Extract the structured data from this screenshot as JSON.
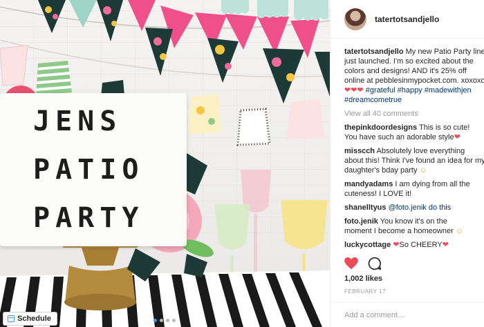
{
  "post": {
    "lightbox_lines": [
      "JENS",
      "PATIO",
      "PARTY"
    ],
    "schedule_label": "Schedule",
    "carousel": {
      "count": 4,
      "active": 0
    }
  },
  "header": {
    "username": "tatertotsandjello"
  },
  "caption": {
    "username": "tatertotsandjello",
    "lines": [
      "My new Patio Party line",
      "just launched. I'm so excited about the",
      "colors and designs! AND it's 25% off",
      "online at pebblesinmypocket.com. xoxoxo"
    ],
    "emoji_hearts": "❤❤❤",
    "hashtags_line1": [
      "#grateful",
      "#happy",
      "#madewithjen"
    ],
    "hashtags_line2": [
      "#dreamcometrue"
    ]
  },
  "view_all": "View all 40 comments",
  "comments": [
    {
      "user": "thepinkdoordesigns",
      "lines": [
        "This is so cute!",
        "You have such an adorable style"
      ],
      "emoji": "❤"
    },
    {
      "user": "misscch",
      "lines": [
        "Absolutely love everything",
        "about this! Think I've found an idea for my",
        "daughter's bday party"
      ],
      "emoji": "☺"
    },
    {
      "user": "mandyadams",
      "lines": [
        "I am dying from all the",
        "cuteness! I LOVE it!"
      ],
      "emoji": ""
    },
    {
      "user": "shanelltyus",
      "lines": [
        "@foto.jenik do this"
      ],
      "emoji": ""
    },
    {
      "user": "foto.jenik",
      "lines": [
        "You know it's on the",
        "moment I become a homeowner"
      ],
      "emoji": "☺"
    },
    {
      "user": "luckycottage",
      "lines": [
        "So CHEERY"
      ],
      "emoji": "❤"
    }
  ],
  "likes": "1,002 likes",
  "date": "FEBRUARY 17",
  "add_comment_placeholder": "Add a comment…",
  "colors": {
    "pink_bunting": "#f0508a",
    "floral_dark": "#1e3a36",
    "link": "#003569",
    "like_heart": "#ed4956",
    "stripe": "#1a1a1a",
    "gold": "#b48a3c"
  }
}
